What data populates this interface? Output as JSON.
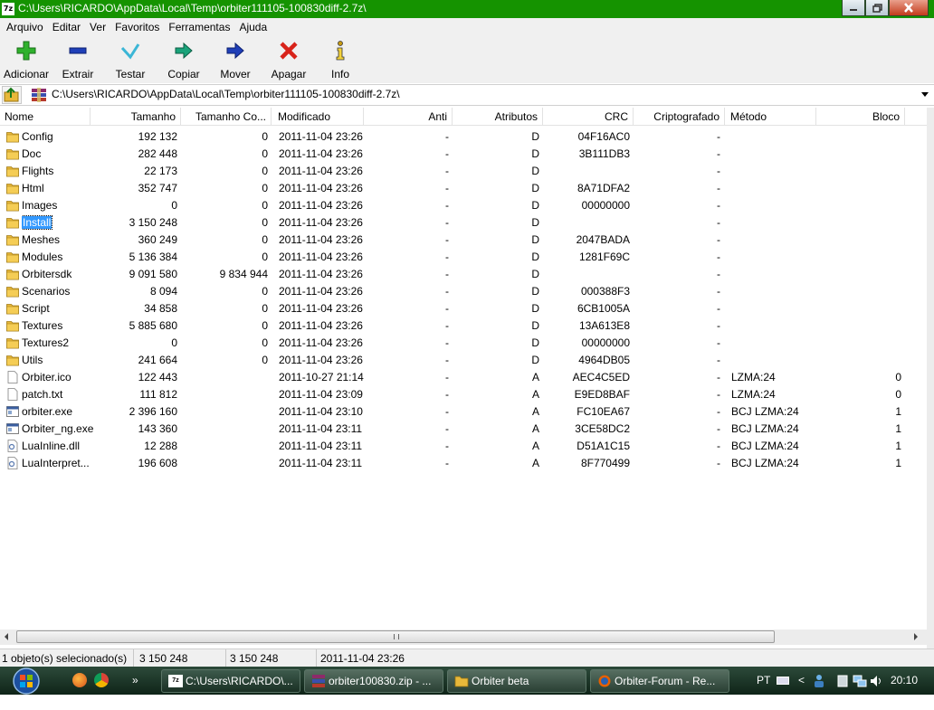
{
  "window": {
    "title": "C:\\Users\\RICARDO\\AppData\\Local\\Temp\\orbiter111105-100830diff-2.7z\\",
    "app_icon_text": "7z"
  },
  "menu": [
    "Arquivo",
    "Editar",
    "Ver",
    "Favoritos",
    "Ferramentas",
    "Ajuda"
  ],
  "toolbar": {
    "add": "Adicionar",
    "extract": "Extrair",
    "test": "Testar",
    "copy": "Copiar",
    "move": "Mover",
    "delete": "Apagar",
    "info": "Info"
  },
  "address": {
    "path": "C:\\Users\\RICARDO\\AppData\\Local\\Temp\\orbiter111105-100830diff-2.7z\\"
  },
  "columns": {
    "name": "Nome",
    "size": "Tamanho",
    "packed": "Tamanho Co...",
    "modified": "Modificado",
    "anti": "Anti",
    "attributes": "Atributos",
    "crc": "CRC",
    "encrypted": "Criptografado",
    "method": "Método",
    "block": "Bloco"
  },
  "rows": [
    {
      "name": "Config",
      "icon": "folder-icon",
      "size": "192 132",
      "packed": "0",
      "modified": "2011-11-04 23:26",
      "anti": "-",
      "attr": "D",
      "crc": "04F16AC0",
      "enc": "-",
      "method": "",
      "block": ""
    },
    {
      "name": "Doc",
      "icon": "folder-icon",
      "size": "282 448",
      "packed": "0",
      "modified": "2011-11-04 23:26",
      "anti": "-",
      "attr": "D",
      "crc": "3B111DB3",
      "enc": "-",
      "method": "",
      "block": ""
    },
    {
      "name": "Flights",
      "icon": "folder-icon",
      "size": "22 173",
      "packed": "0",
      "modified": "2011-11-04 23:26",
      "anti": "-",
      "attr": "D",
      "crc": "",
      "enc": "-",
      "method": "",
      "block": ""
    },
    {
      "name": "Html",
      "icon": "folder-icon",
      "size": "352 747",
      "packed": "0",
      "modified": "2011-11-04 23:26",
      "anti": "-",
      "attr": "D",
      "crc": "8A71DFA2",
      "enc": "-",
      "method": "",
      "block": ""
    },
    {
      "name": "Images",
      "icon": "folder-icon",
      "size": "0",
      "packed": "0",
      "modified": "2011-11-04 23:26",
      "anti": "-",
      "attr": "D",
      "crc": "00000000",
      "enc": "-",
      "method": "",
      "block": ""
    },
    {
      "name": "Install",
      "icon": "folder-icon",
      "size": "3 150 248",
      "packed": "0",
      "modified": "2011-11-04 23:26",
      "anti": "-",
      "attr": "D",
      "crc": "",
      "enc": "-",
      "method": "",
      "block": "",
      "selected": true
    },
    {
      "name": "Meshes",
      "icon": "folder-icon",
      "size": "360 249",
      "packed": "0",
      "modified": "2011-11-04 23:26",
      "anti": "-",
      "attr": "D",
      "crc": "2047BADA",
      "enc": "-",
      "method": "",
      "block": ""
    },
    {
      "name": "Modules",
      "icon": "folder-icon",
      "size": "5 136 384",
      "packed": "0",
      "modified": "2011-11-04 23:26",
      "anti": "-",
      "attr": "D",
      "crc": "1281F69C",
      "enc": "-",
      "method": "",
      "block": ""
    },
    {
      "name": "Orbitersdk",
      "icon": "folder-icon",
      "size": "9 091 580",
      "packed": "9 834 944",
      "modified": "2011-11-04 23:26",
      "anti": "-",
      "attr": "D",
      "crc": "",
      "enc": "-",
      "method": "",
      "block": ""
    },
    {
      "name": "Scenarios",
      "icon": "folder-icon",
      "size": "8 094",
      "packed": "0",
      "modified": "2011-11-04 23:26",
      "anti": "-",
      "attr": "D",
      "crc": "000388F3",
      "enc": "-",
      "method": "",
      "block": ""
    },
    {
      "name": "Script",
      "icon": "folder-icon",
      "size": "34 858",
      "packed": "0",
      "modified": "2011-11-04 23:26",
      "anti": "-",
      "attr": "D",
      "crc": "6CB1005A",
      "enc": "-",
      "method": "",
      "block": ""
    },
    {
      "name": "Textures",
      "icon": "folder-icon",
      "size": "5 885 680",
      "packed": "0",
      "modified": "2011-11-04 23:26",
      "anti": "-",
      "attr": "D",
      "crc": "13A613E8",
      "enc": "-",
      "method": "",
      "block": ""
    },
    {
      "name": "Textures2",
      "icon": "folder-icon",
      "size": "0",
      "packed": "0",
      "modified": "2011-11-04 23:26",
      "anti": "-",
      "attr": "D",
      "crc": "00000000",
      "enc": "-",
      "method": "",
      "block": ""
    },
    {
      "name": "Utils",
      "icon": "folder-icon",
      "size": "241 664",
      "packed": "0",
      "modified": "2011-11-04 23:26",
      "anti": "-",
      "attr": "D",
      "crc": "4964DB05",
      "enc": "-",
      "method": "",
      "block": ""
    },
    {
      "name": "Orbiter.ico",
      "icon": "file-icon",
      "size": "122 443",
      "packed": "",
      "modified": "2011-10-27 21:14",
      "anti": "-",
      "attr": "A",
      "crc": "AEC4C5ED",
      "enc": "-",
      "method": "LZMA:24",
      "block": "0"
    },
    {
      "name": "patch.txt",
      "icon": "file-icon",
      "size": "111 812",
      "packed": "",
      "modified": "2011-11-04 23:09",
      "anti": "-",
      "attr": "A",
      "crc": "E9ED8BAF",
      "enc": "-",
      "method": "LZMA:24",
      "block": "0"
    },
    {
      "name": "orbiter.exe",
      "icon": "exe-icon",
      "size": "2 396 160",
      "packed": "",
      "modified": "2011-11-04 23:10",
      "anti": "-",
      "attr": "A",
      "crc": "FC10EA67",
      "enc": "-",
      "method": "BCJ LZMA:24",
      "block": "1"
    },
    {
      "name": "Orbiter_ng.exe",
      "icon": "exe-icon",
      "size": "143 360",
      "packed": "",
      "modified": "2011-11-04 23:11",
      "anti": "-",
      "attr": "A",
      "crc": "3CE58DC2",
      "enc": "-",
      "method": "BCJ LZMA:24",
      "block": "1"
    },
    {
      "name": "LuaInline.dll",
      "icon": "dll-icon",
      "size": "12 288",
      "packed": "",
      "modified": "2011-11-04 23:11",
      "anti": "-",
      "attr": "A",
      "crc": "D51A1C15",
      "enc": "-",
      "method": "BCJ LZMA:24",
      "block": "1"
    },
    {
      "name": "LuaInterpret...",
      "icon": "dll-icon",
      "size": "196 608",
      "packed": "",
      "modified": "2011-11-04 23:11",
      "anti": "-",
      "attr": "A",
      "crc": "8F770499",
      "enc": "-",
      "method": "BCJ LZMA:24",
      "block": "1"
    }
  ],
  "status": {
    "selected": "1 objeto(s) selecionado(s)",
    "size": "3 150 248",
    "packed": "3 150 248",
    "modified": "2011-11-04 23:26"
  },
  "taskbar": {
    "items": [
      {
        "label": "C:\\Users\\RICARDO\\...",
        "icon": "sevenzip-icon"
      },
      {
        "label": "orbiter100830.zip - ...",
        "icon": "winrar-icon"
      },
      {
        "label": "Orbiter beta",
        "icon": "folder-icon"
      },
      {
        "label": "Orbiter-Forum - Re...",
        "icon": "firefox-icon"
      }
    ],
    "language": "PT",
    "time": "20:10",
    "overflow_glyph": "»",
    "tray_arrow": "<"
  },
  "colors": {
    "title_bar": "#159300",
    "selection": "#3399ff",
    "folder": "#e8b83a",
    "add_green": "#2fb12c",
    "delete_red": "#d8231a"
  }
}
